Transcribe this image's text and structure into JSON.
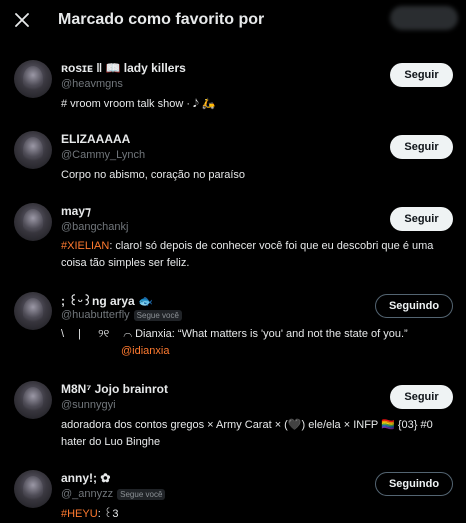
{
  "header": {
    "title": "Marcado como favorito por",
    "close_label": "×"
  },
  "users": [
    {
      "name": "ʀᴏsɪᴇ ‖ 📖 lady killers",
      "handle": "@heavmgns",
      "bio": "#   vroom vroom talk show · 𝅘𝅥𝅮 🛵",
      "button": "Seguir"
    },
    {
      "name": "ELIZAAAAA",
      "handle": "@Cammy_Lynch",
      "bio": "Corpo no abismo, coração no paraíso",
      "button": "Seguir"
    },
    {
      "name": "may⁊",
      "handle": "@bangchankj",
      "bio_tag": "#XIELIAN",
      "bio": ": claro! só depois de conhecer você foi que eu descobri que é uma coisa tão simples ser feliz.",
      "button": "Seguir"
    },
    {
      "name": "; ꒰ᵕ꒱ng arya 🐟",
      "handle": "@huabutterfly",
      "follows_you": "Segue você",
      "bio": "\\ 　| 　 ୨୧ 　⌒ Dianxia: “What matters is 'you' and not the state of you.”",
      "bio_mention": "@idianxia",
      "button": "Seguindo"
    },
    {
      "name": "M8N⁷ Jojo brainrot",
      "handle": "@sunnygyi",
      "bio": "adoradora dos contos gregos × Army Carat × (🖤) ele/ela × INFP 🏳️‍🌈 {03} #0 hater do Luo Binghe",
      "button": "Seguir"
    },
    {
      "name": "anny!; ✿",
      "handle": "@_annyzz",
      "follows_you": "Segue você",
      "bio_tag": "#HEYU",
      "bio": ": ꒰3",
      "button": "Seguindo"
    }
  ],
  "colors": {
    "background": "#000000",
    "accent_hashtag": "#ff7a2f",
    "muted": "#71767b"
  }
}
